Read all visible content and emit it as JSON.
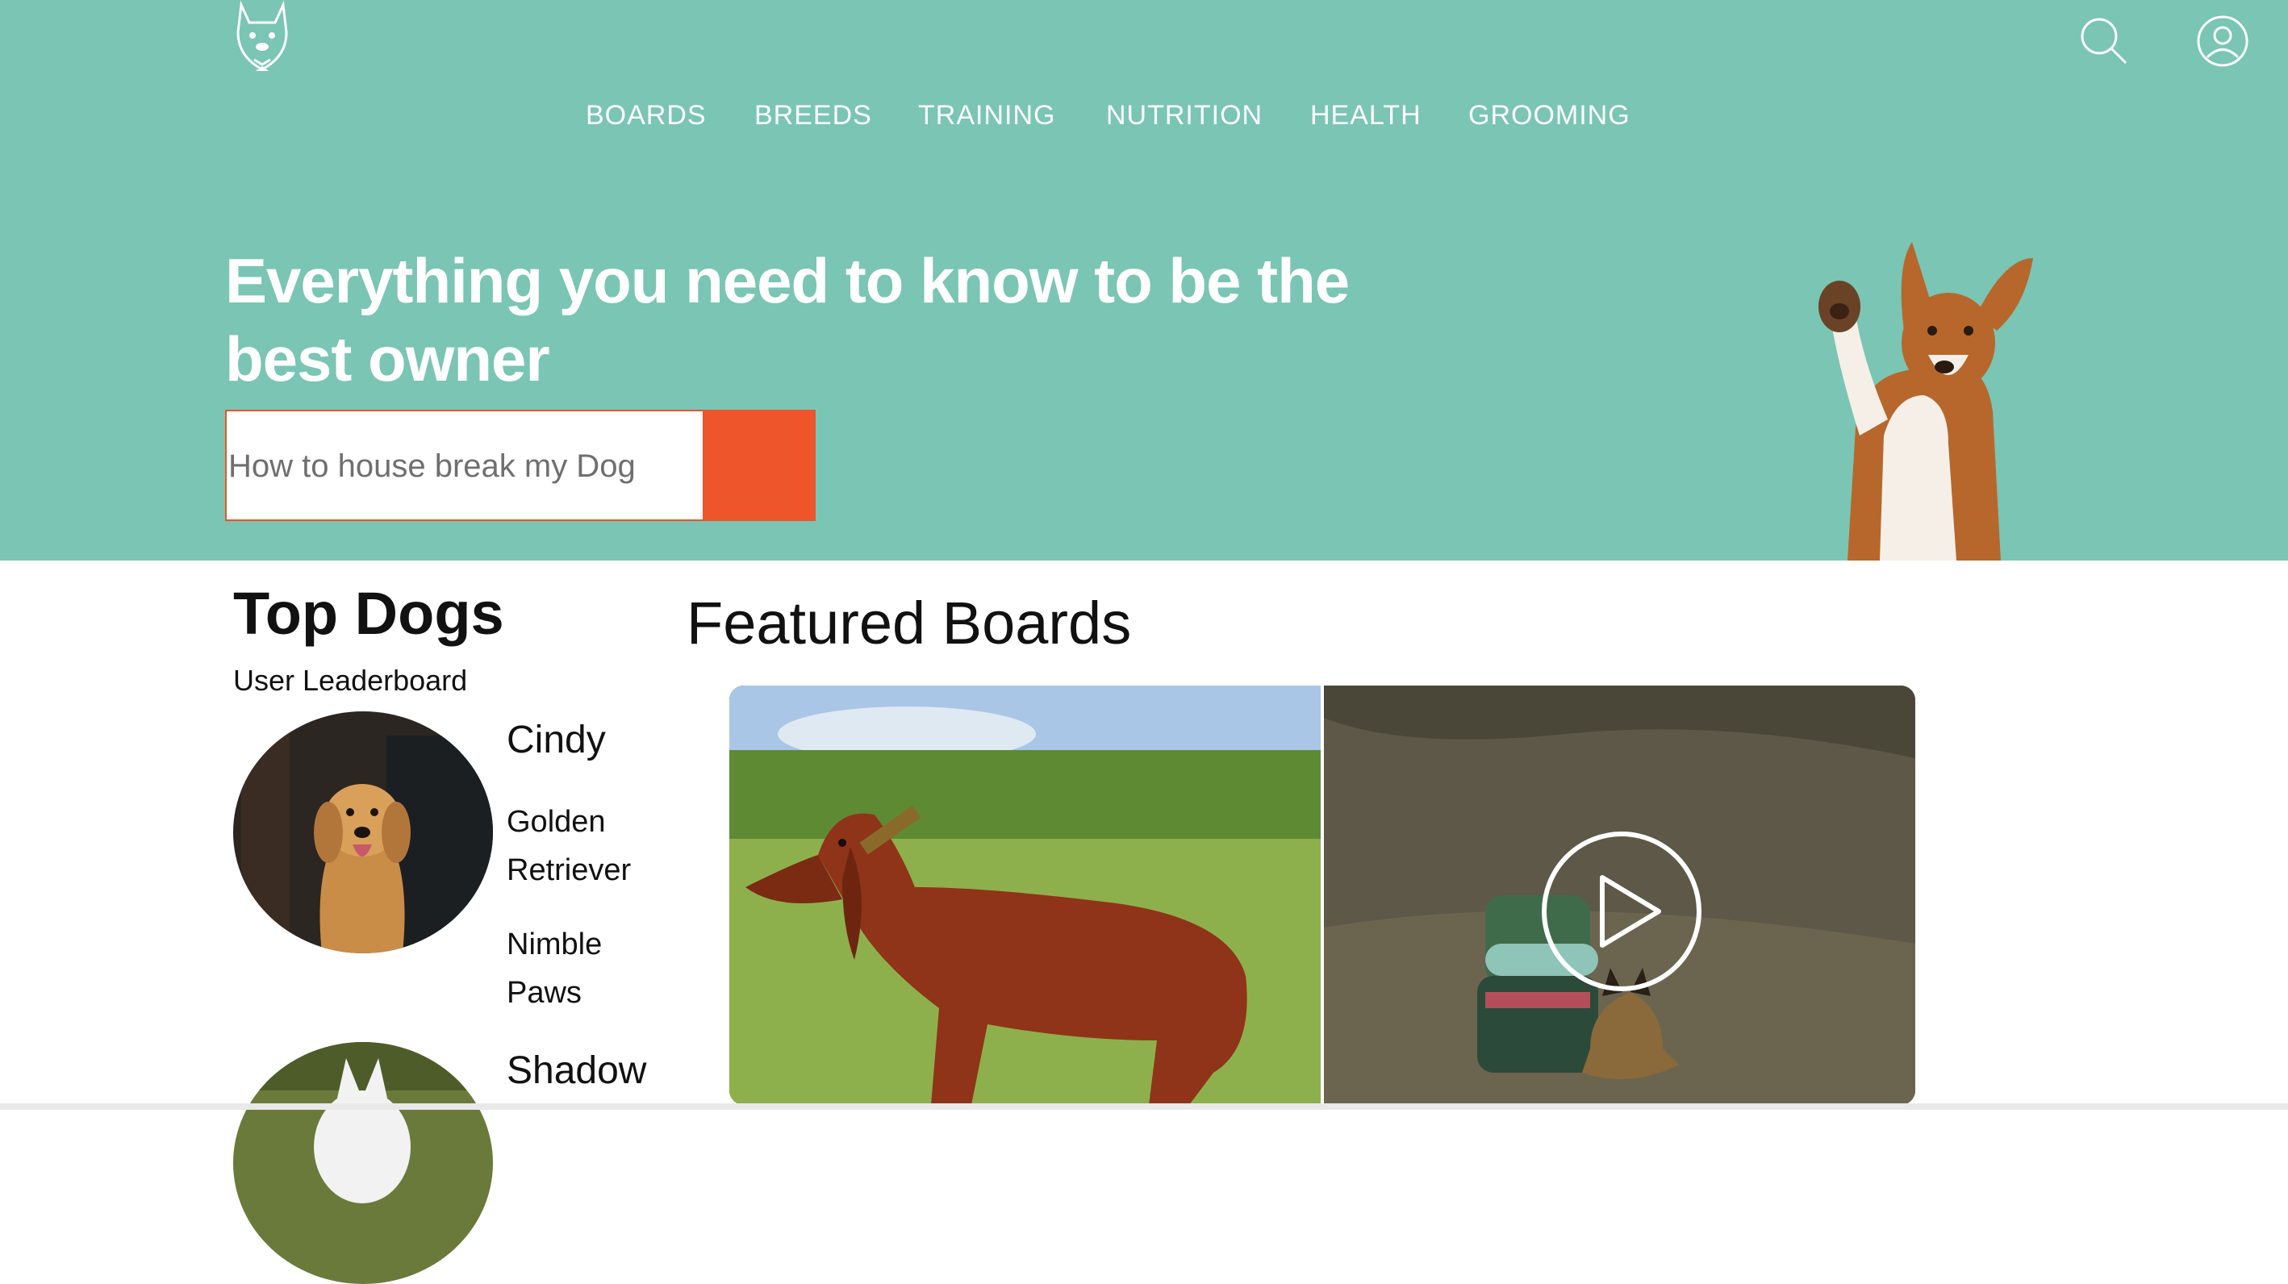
{
  "header": {
    "logo_icon": "dog-head-logo-icon",
    "search_icon": "search-icon",
    "account_icon": "user-circle-icon"
  },
  "nav": {
    "items": [
      "BOARDS",
      "BREEDS",
      "TRAINING",
      "NUTRITION",
      "HEALTH",
      "GROOMING"
    ]
  },
  "hero": {
    "headline": "Everything you need to know to be the best owner",
    "search_placeholder": "How to house break my Dog",
    "search_button_color": "#ef552a",
    "background_color": "#7ac5b4"
  },
  "top_dogs": {
    "title": "Top Dogs",
    "subtitle": "User Leaderboard",
    "dogs": [
      {
        "name": "Cindy",
        "breed": "Golden Retriever",
        "owner": "Nimble Paws"
      },
      {
        "name": "Shadow"
      }
    ]
  },
  "featured": {
    "title": "Featured Boards"
  }
}
